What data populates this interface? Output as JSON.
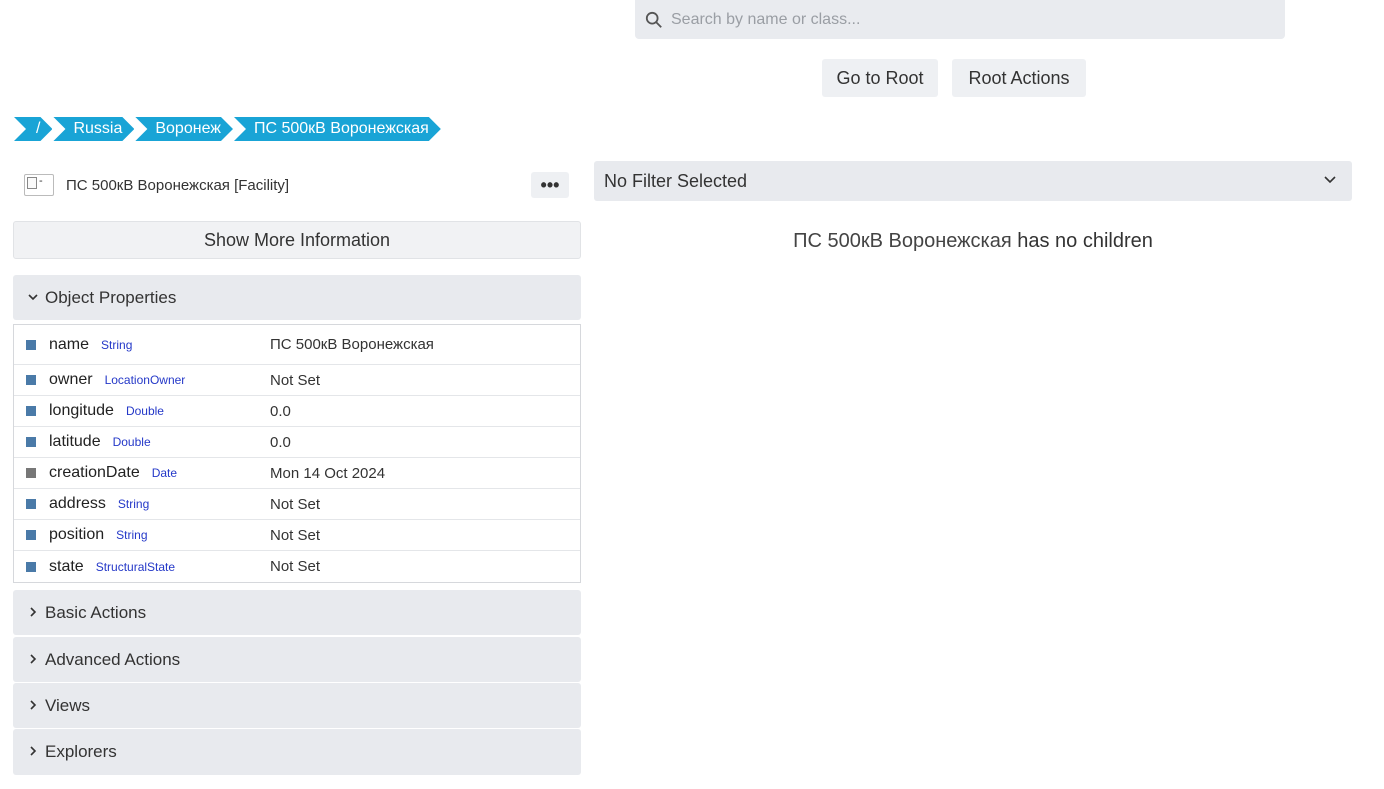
{
  "search": {
    "placeholder": "Search by name or class..."
  },
  "top_buttons": {
    "go_to_root": "Go to Root",
    "root_actions": "Root Actions"
  },
  "breadcrumb": [
    {
      "label": "/"
    },
    {
      "label": "Russia"
    },
    {
      "label": "Воронеж"
    },
    {
      "label": "ПС 500кВ Воронежская"
    }
  ],
  "facility": {
    "title": "ПС 500кВ Воронежская [Facility]",
    "more_label": "•••",
    "image_alt": "-"
  },
  "show_more": "Show More Information",
  "sections": {
    "object_properties": "Object Properties",
    "basic_actions": "Basic Actions",
    "advanced_actions": "Advanced Actions",
    "views": "Views",
    "explorers": "Explorers"
  },
  "properties": [
    {
      "name": "name",
      "type": "String",
      "value": "ПС 500кВ Воронежская"
    },
    {
      "name": "owner",
      "type": "LocationOwner",
      "value": "Not Set"
    },
    {
      "name": "longitude",
      "type": "Double",
      "value": "0.0"
    },
    {
      "name": "latitude",
      "type": "Double",
      "value": "0.0"
    },
    {
      "name": "creationDate",
      "type": "Date",
      "value": "Mon 14 Oct 2024"
    },
    {
      "name": "address",
      "type": "String",
      "value": "Not Set"
    },
    {
      "name": "position",
      "type": "String",
      "value": "Not Set"
    },
    {
      "name": "state",
      "type": "StructuralState",
      "value": "Not Set"
    }
  ],
  "filter": {
    "label": "No Filter Selected"
  },
  "children_message": {
    "object_name": "ПС 500кВ Воронежская",
    "suffix": " has no children"
  },
  "colors": {
    "breadcrumb": "#19a4d6",
    "property_marker": "#4a7aa8",
    "type_text": "#2438c8",
    "panel": "#e8eaee"
  }
}
